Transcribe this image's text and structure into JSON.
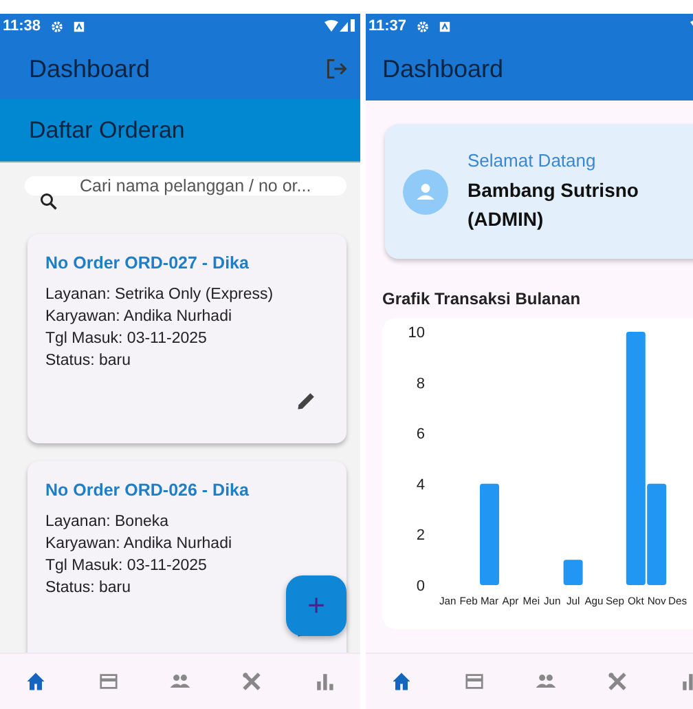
{
  "order_screen": {
    "status_bar": {
      "time": "11:38"
    },
    "app_bar": {
      "title": "Dashboard"
    },
    "section_header": "Daftar Orderan",
    "search": {
      "placeholder": "Cari nama pelanggan / no or..."
    },
    "orders": [
      {
        "title": "No Order ORD-027 - Dika",
        "lines": [
          "Layanan: Setrika Only (Express)",
          "Karyawan: Andika Nurhadi",
          "Tgl Masuk: 03-11-2025",
          "Status: baru"
        ]
      },
      {
        "title": "No Order ORD-026 - Dika",
        "lines": [
          "Layanan: Boneka",
          "Karyawan: Andika Nurhadi",
          "Tgl Masuk: 03-11-2025",
          "Status: baru"
        ]
      }
    ],
    "fab": "+",
    "nav": [
      {
        "kind": "home",
        "selected": true
      },
      {
        "kind": "card",
        "selected": false
      },
      {
        "kind": "people",
        "selected": false
      },
      {
        "kind": "tools",
        "selected": false
      },
      {
        "kind": "chart",
        "selected": false
      }
    ]
  },
  "dashboard_screen": {
    "status_bar": {
      "time": "11:37"
    },
    "app_bar": {
      "title": "Dashboard"
    },
    "welcome": {
      "greeting": "Selamat Datang",
      "name": "Bambang Sutrisno (ADMIN)"
    },
    "chart_title": "Grafik Transaksi Bulanan",
    "chart_data": {
      "type": "bar",
      "categories": [
        "Jan",
        "Feb",
        "Mar",
        "Apr",
        "Mei",
        "Jun",
        "Jul",
        "Agu",
        "Sep",
        "Okt",
        "Nov",
        "Des"
      ],
      "values": [
        0,
        0,
        4,
        0,
        0,
        0,
        1,
        0,
        0,
        10,
        4,
        0
      ],
      "ylim": [
        0,
        10
      ],
      "yticks": [
        0,
        2,
        4,
        6,
        8,
        10
      ]
    },
    "nav": [
      {
        "kind": "home",
        "selected": true
      },
      {
        "kind": "card",
        "selected": false
      },
      {
        "kind": "people",
        "selected": false
      },
      {
        "kind": "tools",
        "selected": false
      },
      {
        "kind": "chart",
        "selected": false
      }
    ]
  }
}
